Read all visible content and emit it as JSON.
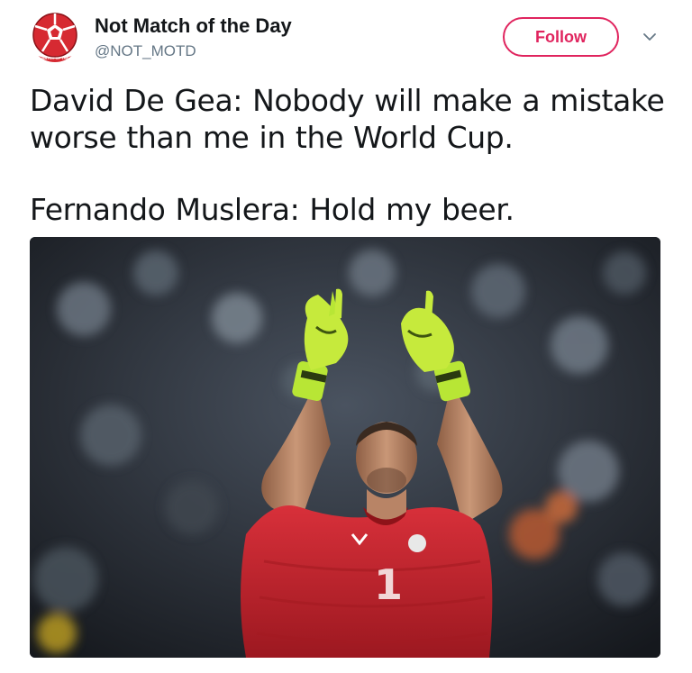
{
  "account": {
    "display_name": "Not Match of the Day",
    "handle": "@NOT_MOTD",
    "avatar_icon": "football-logo-icon",
    "avatar_lettering": "NOT MATCH OF THE DAY"
  },
  "actions": {
    "follow_label": "Follow",
    "menu_icon": "chevron-down-icon"
  },
  "tweet": {
    "line1": "David De Gea: Nobody will make a mistake",
    "line2": "worse than me in the World Cup.",
    "line3": "Fernando Muslera: Hold my beer."
  },
  "media": {
    "shirt_number": "1"
  },
  "colors": {
    "accent": "#e0245e",
    "text": "#14171a",
    "secondary": "#657786",
    "jersey": "#c8202c",
    "gloves": "#b8e635"
  }
}
